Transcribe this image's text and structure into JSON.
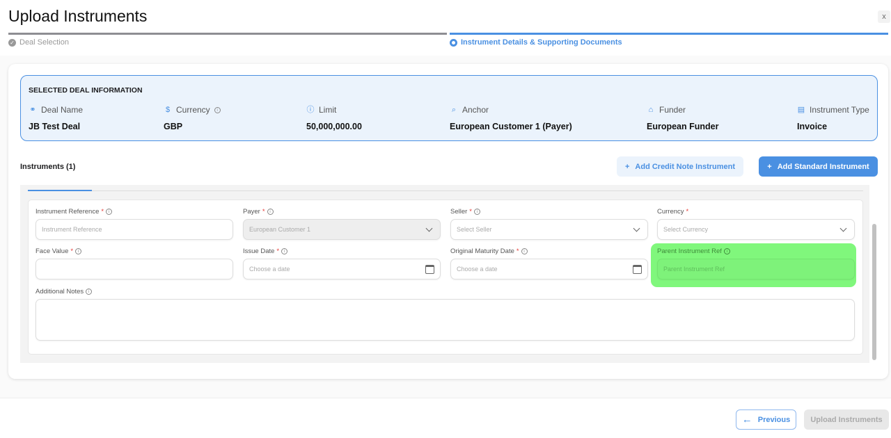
{
  "header": {
    "title": "Upload Instruments",
    "close_label": "x"
  },
  "steps": [
    {
      "label": "Deal Selection",
      "state": "done"
    },
    {
      "label": "Instrument Details & Supporting Documents",
      "state": "active"
    }
  ],
  "deal": {
    "heading": "SELECTED DEAL INFORMATION",
    "fields": [
      {
        "label": "Deal Name",
        "value": "JB Test Deal",
        "icon": "handshake-icon"
      },
      {
        "label": "Currency",
        "value": "GBP",
        "icon": "currency-exchange-icon"
      },
      {
        "label": "Limit",
        "value": "50,000,000.00",
        "icon": "alert-circle-icon"
      },
      {
        "label": "Anchor",
        "value": "European Customer 1 (Payer)",
        "icon": "anchor-search-icon"
      },
      {
        "label": "Funder",
        "value": "European Funder",
        "icon": "bank-icon"
      },
      {
        "label": "Instrument Type",
        "value": "Invoice",
        "icon": "document-icon"
      }
    ]
  },
  "instruments": {
    "label": "Instruments (1)",
    "add_credit_note": "Add Credit Note Instrument",
    "add_standard": "Add Standard Instrument"
  },
  "form": {
    "instrument_reference": {
      "label": "Instrument Reference",
      "placeholder": "Instrument Reference"
    },
    "payer": {
      "label": "Payer",
      "value": "European Customer 1"
    },
    "seller": {
      "label": "Seller",
      "placeholder": "Select Seller"
    },
    "currency": {
      "label": "Currency",
      "placeholder": "Select Currency"
    },
    "face_value": {
      "label": "Face Value",
      "value": ""
    },
    "issue_date": {
      "label": "Issue Date",
      "placeholder": "Choose a date"
    },
    "maturity_date": {
      "label": "Original Maturity Date",
      "placeholder": "Choose a date"
    },
    "parent_ref": {
      "label": "Parent Instrument Ref",
      "placeholder": "Parent Instrument Ref"
    },
    "notes": {
      "label": "Additional Notes",
      "value": ""
    },
    "required_mark": "*"
  },
  "footer": {
    "previous": "Previous",
    "upload": "Upload Instruments"
  },
  "colors": {
    "accent": "#4a90e2",
    "highlight": "#80f77c"
  }
}
